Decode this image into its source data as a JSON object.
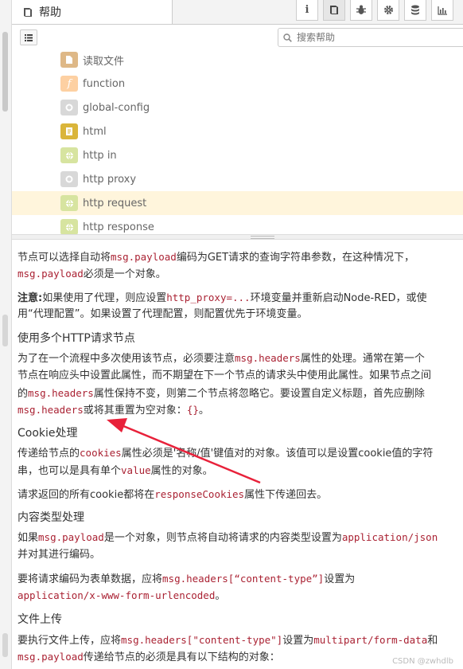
{
  "tabs": {
    "help": "帮助"
  },
  "toolbar": {
    "info": "i"
  },
  "search": {
    "placeholder": "搜索帮助"
  },
  "nodes": [
    {
      "label": "读取文件",
      "color": "#deb887",
      "icon": "file-icon"
    },
    {
      "label": "function",
      "color": "#fdd0a2",
      "icon": "function-icon"
    },
    {
      "label": "global-config",
      "color": "#d8d8d8",
      "icon": "cog-icon"
    },
    {
      "label": "html",
      "color": "#dab53a",
      "icon": "html-icon"
    },
    {
      "label": "http in",
      "color": "#d7e4a0",
      "icon": "globe-icon"
    },
    {
      "label": "http proxy",
      "color": "#d8d8d8",
      "icon": "cog-icon"
    },
    {
      "label": "http request",
      "color": "#d7e4a0",
      "icon": "globe-icon",
      "selected": true
    },
    {
      "label": "http response",
      "color": "#d7e4a0",
      "icon": "globe-icon"
    }
  ],
  "help": {
    "p1a": "节点可以选择自动将",
    "p1b": "msg.payload",
    "p1c": "编码为GET请求的查询字符串参数，在这种情况下，",
    "p1d": "msg.payload",
    "p1e": "必须是一个对象。",
    "p2a": "注意:",
    "p2b": "如果使用了代理，则应设置",
    "p2c": "http_proxy=...",
    "p2d": "环境变量并重新启动Node-RED，或使",
    "p2e": "用“代理配置”。如果设置了代理配置，则配置优先于环境变量。",
    "h1": "使用多个HTTP请求节点",
    "p3a": "为了在一个流程中多次使用该节点，必须要注意",
    "p3b": "msg.headers",
    "p3c": "属性的处理。通常在第一个",
    "p3d": "节点在响应头中设置此属性，而不期望在下一个节点的请求头中使用此属性。如果节点之间",
    "p3e": "的",
    "p3f": "msg.headers",
    "p3g": "属性保持不变，则第二个节点将忽略它。要设置自定义标题，首先应删除",
    "p3h": "msg.headers",
    "p3i": "或将其重置为空对象：",
    "p3j": "{}",
    "p3k": "。",
    "h2": "Cookie处理",
    "p4a": "传递给节点的",
    "p4b": "cookies",
    "p4c": "属性必须是'名称/值'键值对的对象。该值可以是设置cookie值的字符",
    "p4d": "串，也可以是具有单个",
    "p4e": "value",
    "p4f": "属性的对象。",
    "p5a": "请求返回的所有cookie都将在",
    "p5b": "responseCookies",
    "p5c": "属性下传递回去。",
    "h3": "内容类型处理",
    "p6a": "如果",
    "p6b": "msg.payload",
    "p6c": "是一个对象，则节点将自动将请求的内容类型设置为",
    "p6d": "application/json",
    "p6e": "并对其进行编码。",
    "p7a": "要将请求编码为表单数据，应将",
    "p7b": "msg.headers[“content-type”]",
    "p7c": "设置为",
    "p7d": "application/x-www-form-urlencoded",
    "p7e": "。",
    "h4": "文件上传",
    "p8a": "要执行文件上传，应将",
    "p8b": "msg.headers[\"content-type\"]",
    "p8c": "设置为",
    "p8d": "multipart/form-data",
    "p8e": "和",
    "p8f": "msg.payload",
    "p8g": "传递给节点的必须是具有以下结构的对象："
  },
  "watermark": "CSDN @zwhdlb"
}
